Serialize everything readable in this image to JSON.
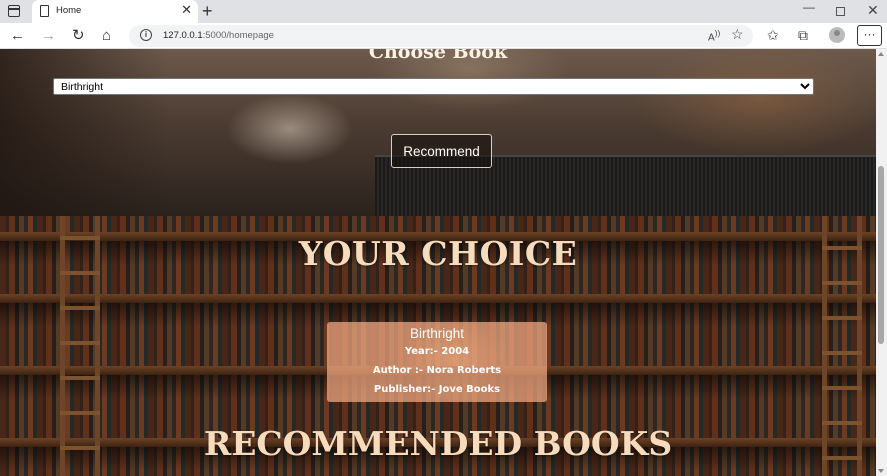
{
  "browser": {
    "tab_title": "Home",
    "tab_close": "✕",
    "new_tab": "+",
    "url_host": "127.0.0.1",
    "url_rest": ":5000/homepage",
    "more_label": "···"
  },
  "hero": {
    "heading": "Choose Book",
    "selected_book": "Birthright",
    "recommend_label": "Recommend"
  },
  "choice": {
    "heading": "YOUR CHOICE",
    "book_name": "Birthright",
    "year_line": "Year:- 2004",
    "author_line": "Author :- Nora Roberts",
    "publisher_line": "Publisher:- Jove Books"
  },
  "recommendations": {
    "heading": "RECOMMENDED BOOKS"
  }
}
